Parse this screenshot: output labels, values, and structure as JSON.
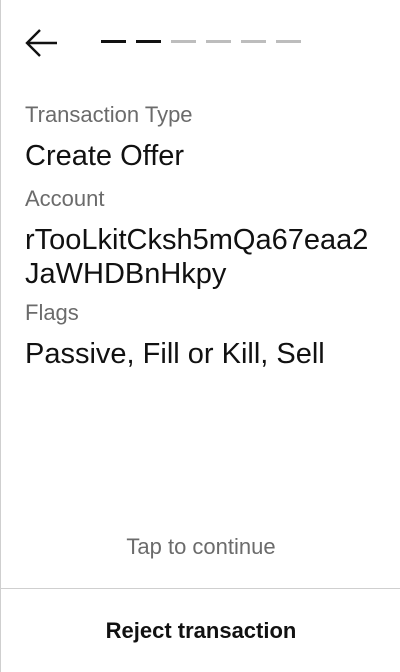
{
  "header": {
    "back_icon": "arrow-left-icon",
    "steps_total": 6,
    "steps_completed": 2
  },
  "fields": {
    "transaction_type": {
      "label": "Transaction Type",
      "value": "Create Offer"
    },
    "account": {
      "label": "Account",
      "value": "rTooLkitCksh5mQa67eaa2JaWHDBnHkpy"
    },
    "flags": {
      "label": "Flags",
      "value": "Passive, Fill or Kill, Sell"
    }
  },
  "footer": {
    "tap_hint": "Tap to continue",
    "reject_label": "Reject transaction"
  },
  "colors": {
    "text_primary": "#111111",
    "text_secondary": "#6b6b6b",
    "step_inactive": "#bdbdbd",
    "divider": "#cfcfcf"
  }
}
